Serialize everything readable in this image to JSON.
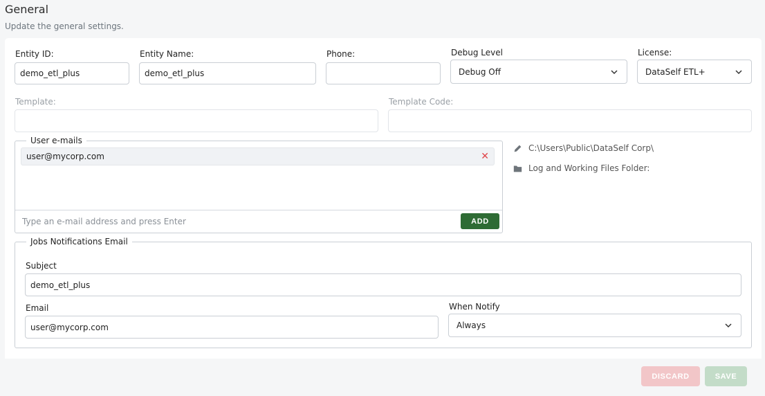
{
  "header": {
    "title": "General",
    "subtitle": "Update the general settings."
  },
  "general": {
    "entity_id": {
      "label": "Entity ID:",
      "value": "demo_etl_plus"
    },
    "entity_name": {
      "label": "Entity Name:",
      "value": "demo_etl_plus"
    },
    "phone": {
      "label": "Phone:",
      "value": ""
    },
    "debug_level": {
      "label": "Debug Level",
      "value": "Debug Off"
    },
    "license": {
      "label": "License:",
      "value": "DataSelf ETL+"
    },
    "template": {
      "label": "Template:",
      "value": ""
    },
    "template_code": {
      "label": "Template Code:",
      "value": ""
    }
  },
  "user_emails": {
    "legend": "User e-mails",
    "items": [
      {
        "email": "user@mycorp.com"
      }
    ],
    "input_placeholder": "Type an e-mail address and press Enter",
    "add_label": "ADD"
  },
  "side_info": {
    "path": "C:\\Users\\Public\\DataSelf Corp\\",
    "folder_label": "Log and Working Files Folder:"
  },
  "jobs": {
    "legend": "Jobs Notifications Email",
    "subject": {
      "label": "Subject",
      "value": "demo_etl_plus"
    },
    "email": {
      "label": "Email",
      "value": "user@mycorp.com"
    },
    "when_notify": {
      "label": "When Notify",
      "value": "Always"
    }
  },
  "footer": {
    "discard_label": "DISCARD",
    "save_label": "SAVE"
  },
  "colors": {
    "add_button": "#2e6b34",
    "discard_button": "#f2c6c8",
    "save_button": "#c3dcc8",
    "remove_icon": "#e0454a"
  },
  "icons": {
    "edit": "pencil-icon",
    "folder": "folder-icon",
    "remove": "close-icon",
    "dropdown": "chevron-down-icon"
  }
}
